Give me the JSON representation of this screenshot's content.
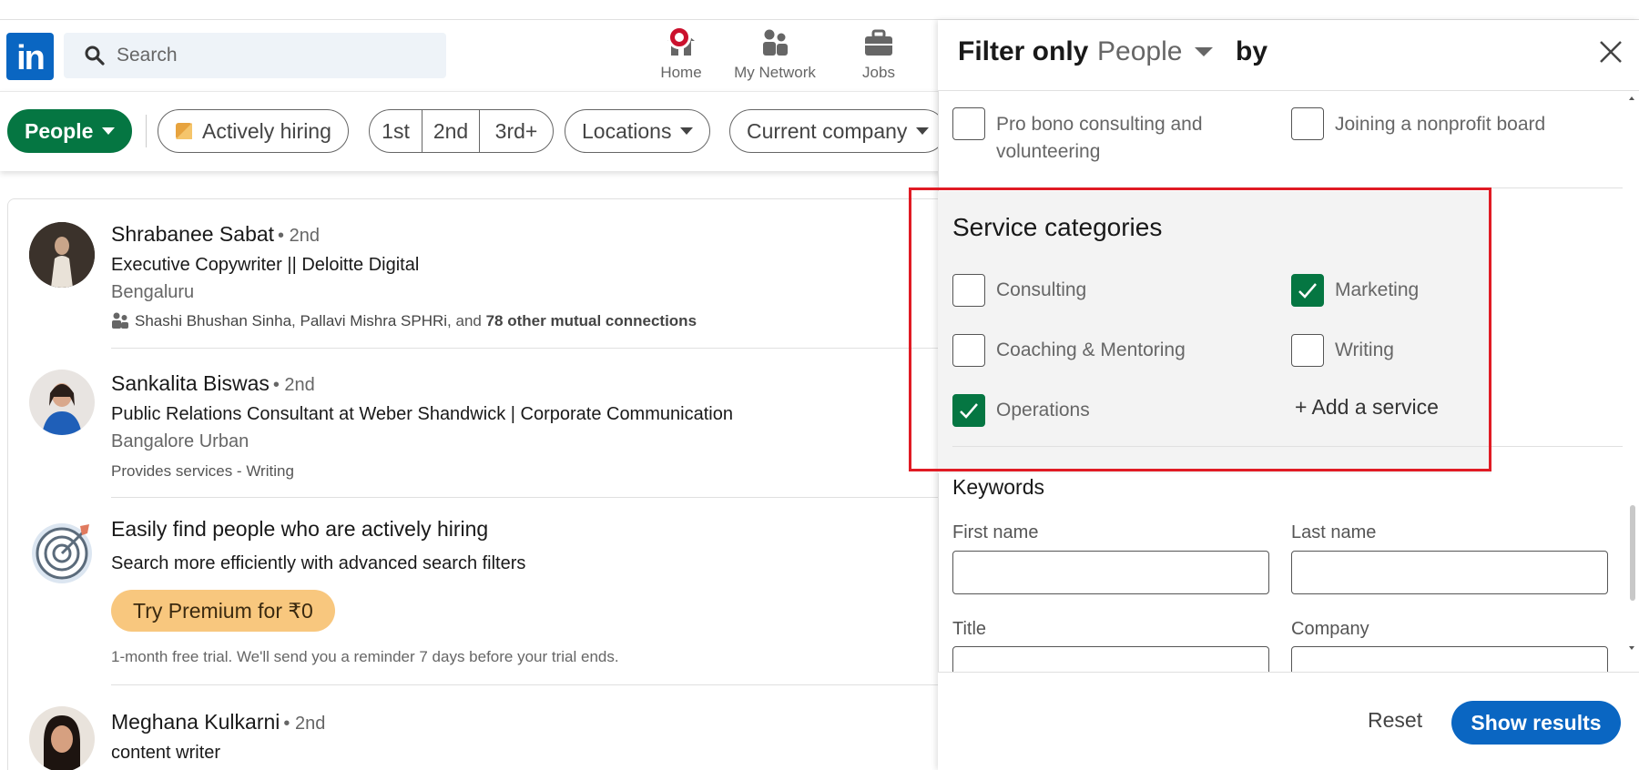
{
  "nav": {
    "logo": "in",
    "search_placeholder": "Search",
    "items": [
      {
        "label": "Home"
      },
      {
        "label": "My Network"
      },
      {
        "label": "Jobs"
      }
    ]
  },
  "filters": {
    "people": "People",
    "actively_hiring": "Actively hiring",
    "degrees": [
      "1st",
      "2nd",
      "3rd+"
    ],
    "locations": "Locations",
    "current_company": "Current company"
  },
  "results": [
    {
      "name": "Shrabanee Sabat",
      "degree": "• 2nd",
      "headline": "Executive Copywriter || Deloitte Digital",
      "location": "Bengaluru",
      "mutual_a": "Shashi Bhushan Sinha",
      "mutual_b": "Pallavi Mishra SPHRi",
      "mutual_sep1": ",",
      "mutual_sep2": ", and",
      "mutual_more": "78 other mutual connections"
    },
    {
      "name": "Sankalita Biswas",
      "degree": "• 2nd",
      "headline": "Public Relations Consultant at Weber Shandwick | Corporate Communication",
      "location": "Bangalore Urban",
      "services": "Provides services - Writing"
    },
    {
      "name": "Meghana Kulkarni",
      "degree": "• 2nd",
      "headline": "content writer"
    }
  ],
  "promo": {
    "title": "Easily find people who are actively hiring",
    "subtitle": "Search more efficiently with advanced search filters",
    "button": "Try Premium for ₹0",
    "note": "1-month free trial. We'll send you a reminder 7 days before your trial ends."
  },
  "panel": {
    "header_prefix": "Filter only",
    "header_dropdown": "People",
    "header_suffix": "by",
    "top_options": [
      {
        "label_line1": "Pro bono consulting and",
        "label_line2": "volunteering",
        "checked": false
      },
      {
        "label_line1": "Joining a nonprofit board",
        "checked": false
      }
    ],
    "service_categories": {
      "title": "Service categories",
      "options": [
        {
          "label": "Consulting",
          "checked": false
        },
        {
          "label": "Marketing",
          "checked": true
        },
        {
          "label": "Coaching & Mentoring",
          "checked": false
        },
        {
          "label": "Writing",
          "checked": false
        },
        {
          "label": "Operations",
          "checked": true
        }
      ],
      "add_service": "+ Add a service"
    },
    "keywords": {
      "title": "Keywords",
      "first_name": {
        "label": "First name",
        "value": ""
      },
      "last_name": {
        "label": "Last name",
        "value": ""
      },
      "title_field": {
        "label": "Title"
      },
      "company_field": {
        "label": "Company"
      }
    },
    "reset": "Reset",
    "show_results": "Show results"
  },
  "colors": {
    "brand": "#0a66c2",
    "green": "#057642",
    "highlight": "#e01b24",
    "premium": "#f8c77e",
    "notification": "#cb112d"
  }
}
